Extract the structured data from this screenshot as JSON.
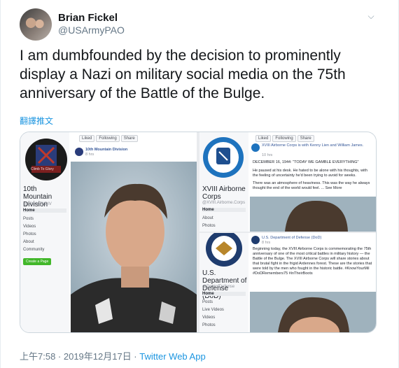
{
  "tweet": {
    "author_name": "Brian Fickel",
    "author_handle": "@USArmyPAO",
    "text": "I am dumbfounded by the decision to prominently display a Nazi on military social media on the 75th anniversary of the Battle of the Bulge.",
    "translate_label": "翻譯推文",
    "timestamp": "上午7:58 · 2019年12月17日 ·",
    "source_app": "Twitter Web App"
  },
  "media": {
    "left_panel": {
      "badge_text": "Climb To Glory",
      "page_name": "10th Mountain Division",
      "page_handle": "@10thMTNDIV",
      "nav": [
        "Home",
        "Posts",
        "Videos",
        "Photos",
        "About",
        "Community"
      ],
      "cta_label": "Create a Page",
      "post_author": "10th Mountain Division",
      "post_time": "8 hrs",
      "buttons": [
        "Liked",
        "Following",
        "Share"
      ]
    },
    "right_top": {
      "page_name": "XVIII Airborne Corps",
      "page_handle": "@XVIII.Airborne.Corps",
      "nav": [
        "Home",
        "About",
        "Photos"
      ],
      "buttons": [
        "Liked",
        "Following",
        "Share"
      ],
      "post_line1": "XVIII Airborne Corps is with Kenny Lien and William James.",
      "post_time": "10 hrs",
      "post_heading": "DECEMBER 16, 1944: \"TODAY WE GAMBLE EVERYTHING\"",
      "post_body1": "He paused at his desk. He hated to be alone with his thoughts, with the feeling of uncertainty he'd been trying to avoid for weeks.",
      "post_body2": "There was an atmosphere of heaviness. This was the way he always thought the end of the world would feel. ... See More"
    },
    "right_bottom": {
      "page_name": "U.S. Department of Defense (DoD)",
      "page_handle": "@DeptofDefense",
      "nav": [
        "Home",
        "Posts",
        "Live Videos",
        "Videos",
        "Photos"
      ],
      "post_author": "U.S. Department of Defense (DoD)",
      "post_time": "8 hrs",
      "post_body": "Beginning today, the XVIII Airborne Corps is commemorating the 75th anniversary of one of the most critical battles in military history — the Battle of the Bulge. The XVIII Airborne Corps will share stories about that brutal fight in the frigid Ardennes forest. These are the stories that were told by the men who fought in the historic battle. #KnowYourMil #DoDRemembers75 #inTheirBoots"
    }
  },
  "colors": {
    "link": "#1b95e0",
    "muted": "#657786",
    "fb_blue": "#365899"
  }
}
